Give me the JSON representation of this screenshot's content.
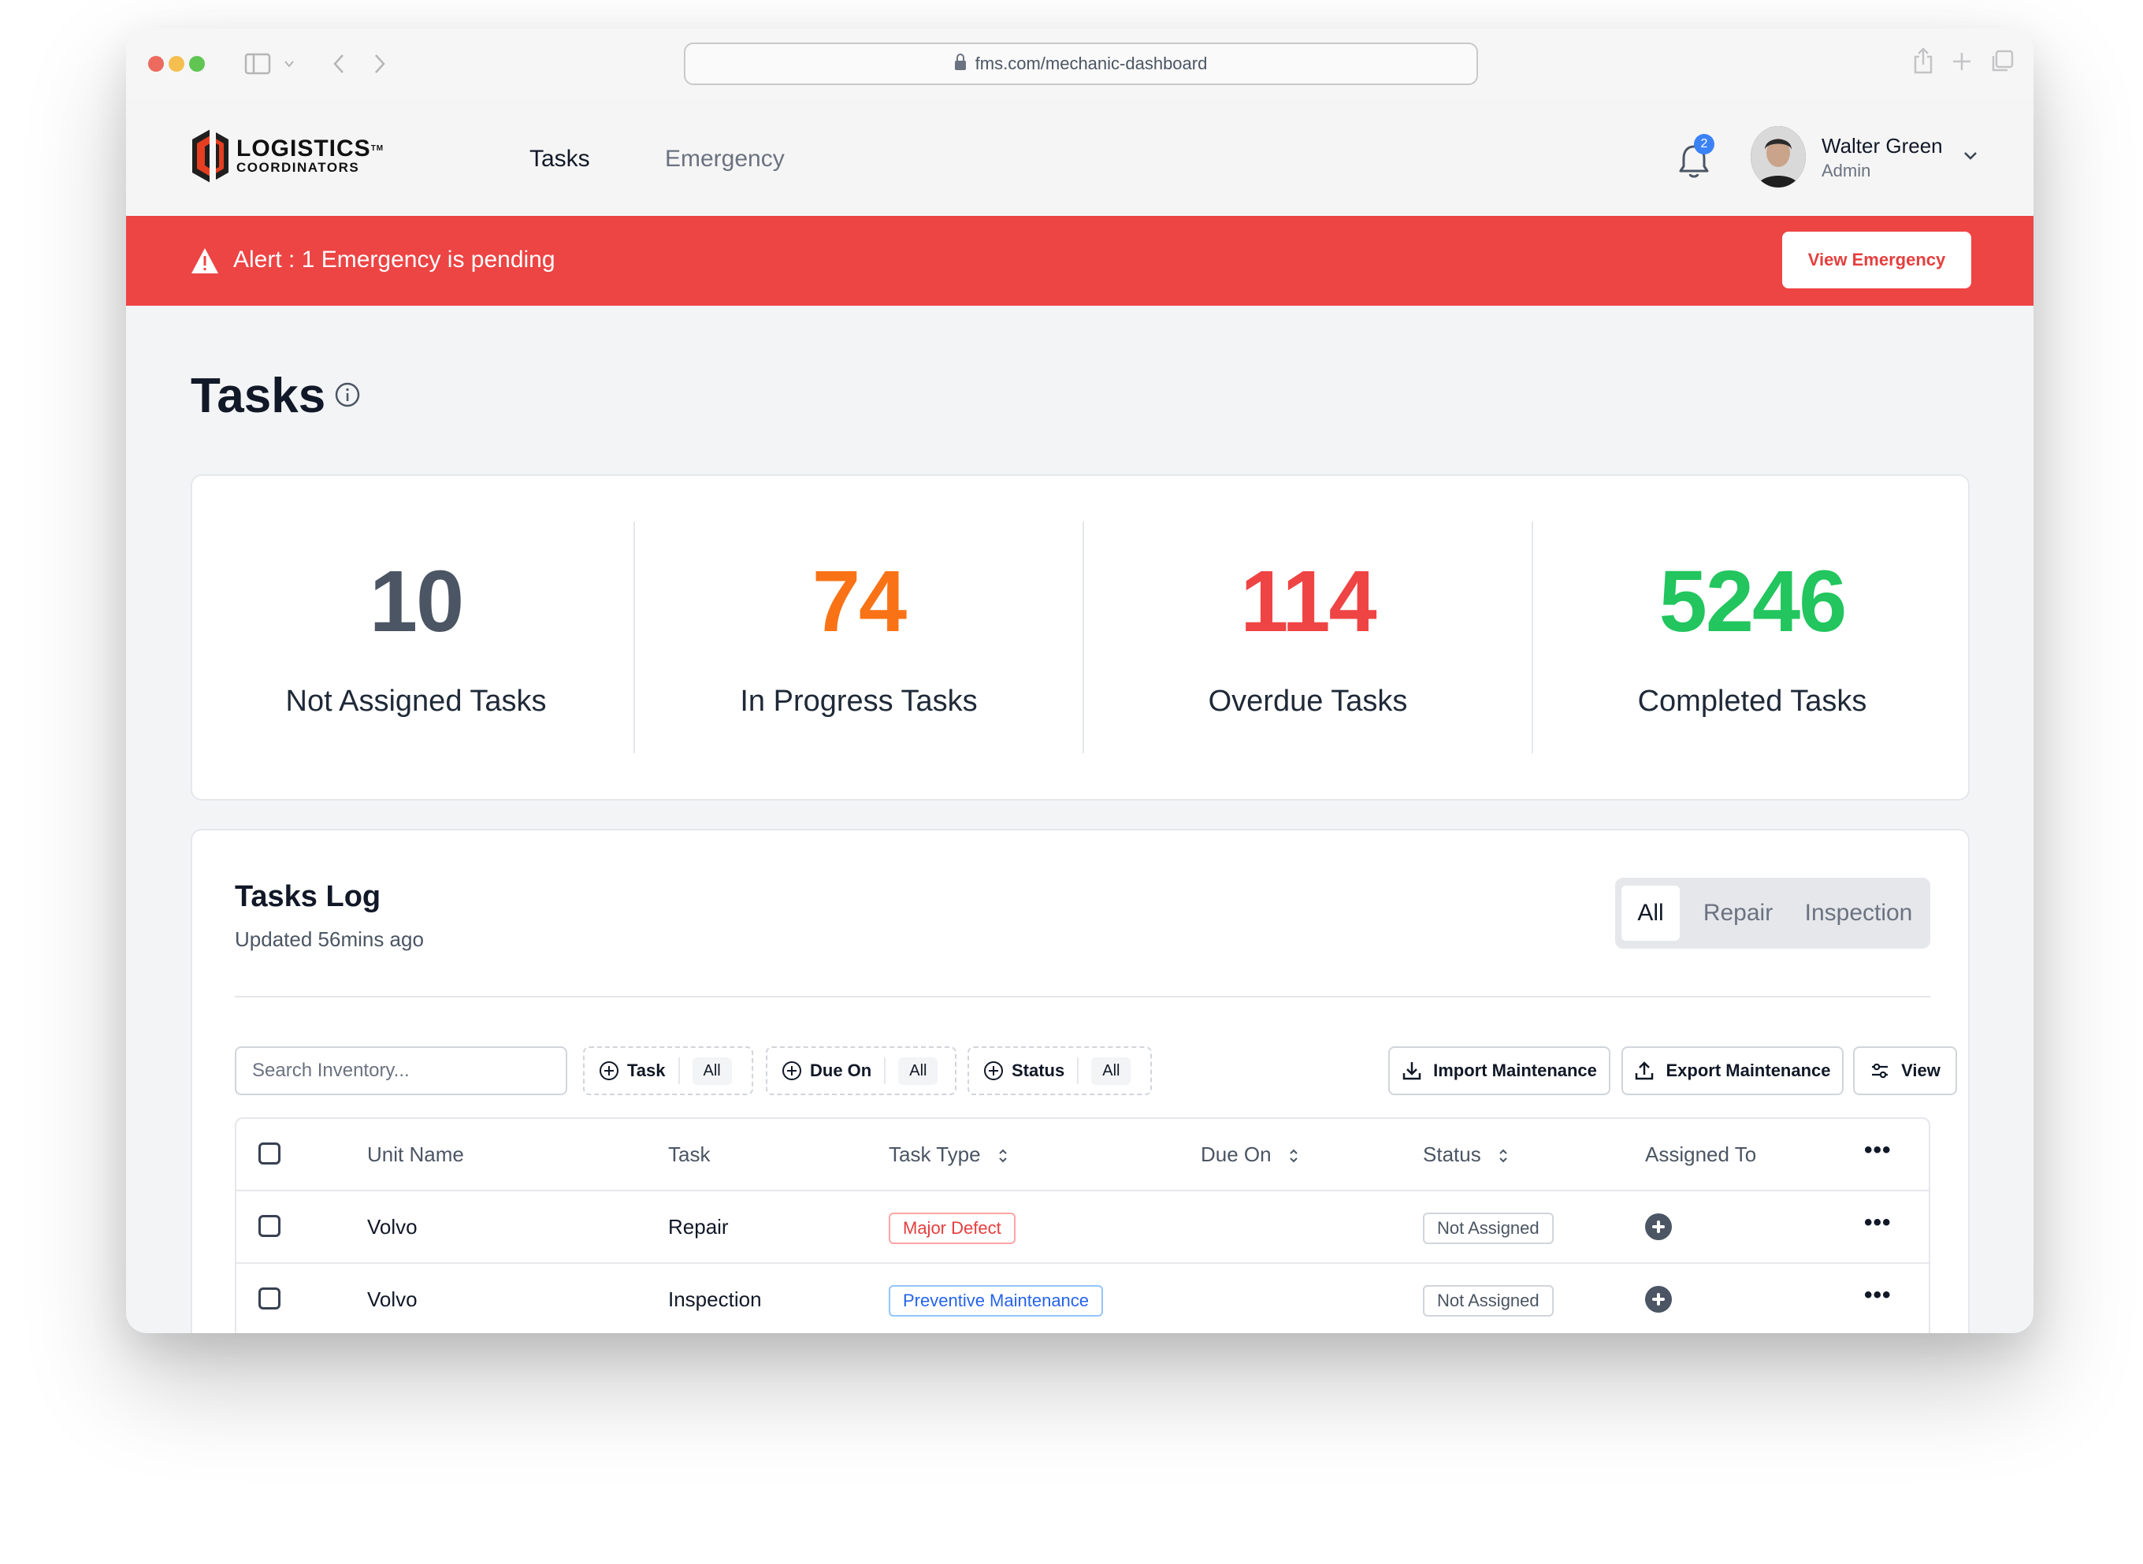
{
  "browser": {
    "url": "fms.com/mechanic-dashboard"
  },
  "header": {
    "logo_line1": "LOGISTICS",
    "logo_tm": "TM",
    "logo_line2": "COORDINATORS",
    "nav": [
      {
        "label": "Tasks",
        "active": true
      },
      {
        "label": "Emergency",
        "active": false
      }
    ],
    "notification_count": "2",
    "user": {
      "name": "Walter Green",
      "role": "Admin"
    }
  },
  "alert": {
    "text": "Alert : 1 Emergency is pending",
    "button": "View Emergency",
    "color": "#ed4444"
  },
  "page": {
    "title": "Tasks"
  },
  "stats": [
    {
      "value": "10",
      "label": "Not Assigned Tasks",
      "color": "#4b5563"
    },
    {
      "value": "74",
      "label": "In Progress Tasks",
      "color": "#f97316"
    },
    {
      "value": "114",
      "label": "Overdue Tasks",
      "color": "#ef4444"
    },
    {
      "value": "5246",
      "label": "Completed Tasks",
      "color": "#22c55e"
    }
  ],
  "tasks_log": {
    "title": "Tasks Log",
    "updated": "Updated 56mins ago",
    "segments": [
      "All",
      "Repair",
      "Inspection"
    ],
    "active_segment": "All",
    "search_placeholder": "Search Inventory...",
    "filters": [
      {
        "label": "Task",
        "value": "All"
      },
      {
        "label": "Due On",
        "value": "All"
      },
      {
        "label": "Status",
        "value": "All"
      }
    ],
    "actions": {
      "import": "Import Maintenance",
      "export": "Export Maintenance",
      "view": "View"
    },
    "columns": [
      "Unit Name",
      "Task",
      "Task Type",
      "Due On",
      "Status",
      "Assigned To"
    ],
    "rows": [
      {
        "unit": "Volvo",
        "task": "Repair",
        "task_type": "Major Defect",
        "task_type_style": "red",
        "due_on": "",
        "status": "Not Assigned"
      },
      {
        "unit": "Volvo",
        "task": "Inspection",
        "task_type": "Preventive Maintenance",
        "task_type_style": "blue",
        "due_on": "",
        "status": "Not Assigned"
      }
    ],
    "more_glyph": "•••"
  }
}
